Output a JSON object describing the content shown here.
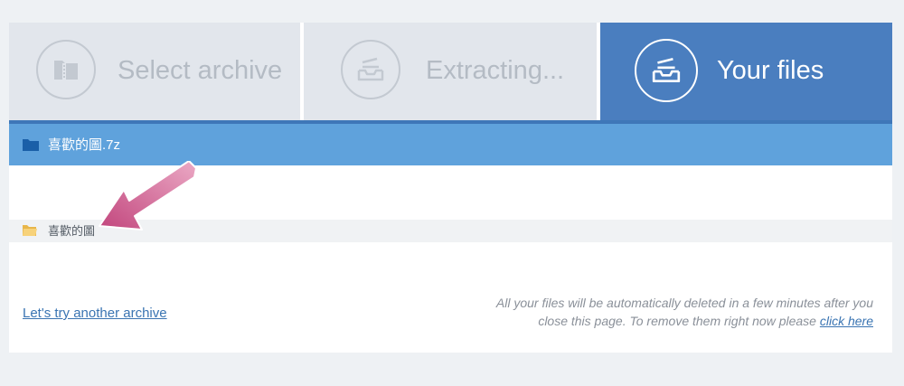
{
  "steps": [
    {
      "label": "Select archive",
      "icon": "zip-archive-icon",
      "state": "inactive"
    },
    {
      "label": "Extracting...",
      "icon": "tray-icon",
      "state": "inactive"
    },
    {
      "label": "Your files",
      "icon": "tray-icon",
      "state": "active"
    }
  ],
  "breadcrumb": {
    "archive_name": "喜歡的圖.7z",
    "icon": "folder-icon"
  },
  "files": [
    {
      "name": "喜歡的圖",
      "type": "folder",
      "icon": "open-folder-icon"
    }
  ],
  "footer": {
    "retry_label": "Let's try another archive",
    "notice_text": "All your files will be automatically deleted in a few minutes after you close this page. To remove them right now please",
    "delete_link": "click here"
  },
  "colors": {
    "active_step": "#4a7ebf",
    "inactive_step": "#e2e6ec",
    "breadcrumb_bar": "#5fa2dc",
    "link": "#3a74b2",
    "annotation_arrow": "#c2467d"
  }
}
